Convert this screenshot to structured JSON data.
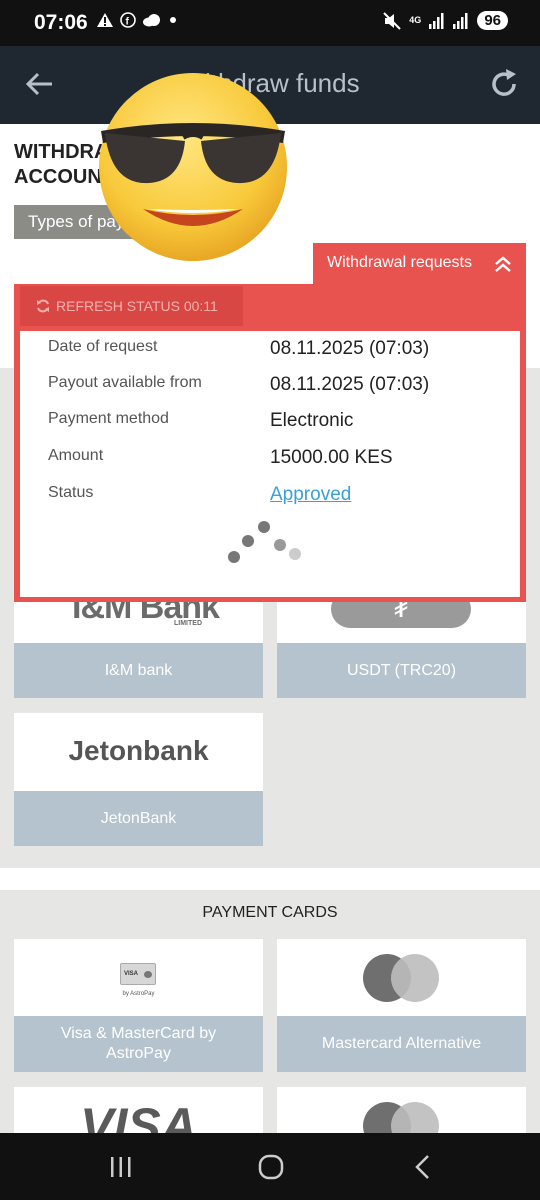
{
  "status_bar": {
    "time": "07:06",
    "network": "4G",
    "battery": "96"
  },
  "header": {
    "title": "Withdraw funds"
  },
  "page": {
    "heading": "WITHDRAW FUNDS FROM ACCOUNT",
    "types_chip": "Types of payment"
  },
  "withdrawal_requests": {
    "tab_label": "Withdrawal requests",
    "refresh_status": "REFRESH STATUS 00:11",
    "rows": [
      {
        "label": "Date of request",
        "value": "08.11.2025 (07:03)"
      },
      {
        "label": "Payout available from",
        "value": "08.11.2025 (07:03)"
      },
      {
        "label": "Payment method",
        "value": "Electronic"
      },
      {
        "label": "Amount",
        "value": "15000.00 KES"
      },
      {
        "label": "Status",
        "value": "Approved"
      }
    ]
  },
  "bank_cards": [
    {
      "label": "I&M bank",
      "logo_text": "I&M Bank",
      "logo_sub": "LIMITED"
    },
    {
      "label": "USDT (TRC20)",
      "logo_text": "₮"
    },
    {
      "label": "JetonBank",
      "logo_text": "Jetonbank"
    }
  ],
  "payment_cards_section": {
    "title": "PAYMENT CARDS",
    "cards": [
      {
        "label": "Visa & MasterCard by AstroPay",
        "logo_small_1": "VISA",
        "logo_small_2": "by AstroPay"
      },
      {
        "label": "Mastercard Alternative"
      },
      {
        "label": "",
        "logo_text": "VISA"
      },
      {
        "label": ""
      }
    ]
  },
  "colors": {
    "header_bg": "#1f2830",
    "accent_red": "#e8524f",
    "card_label_bg": "#b4c3cd",
    "link": "#3aa0d8"
  }
}
